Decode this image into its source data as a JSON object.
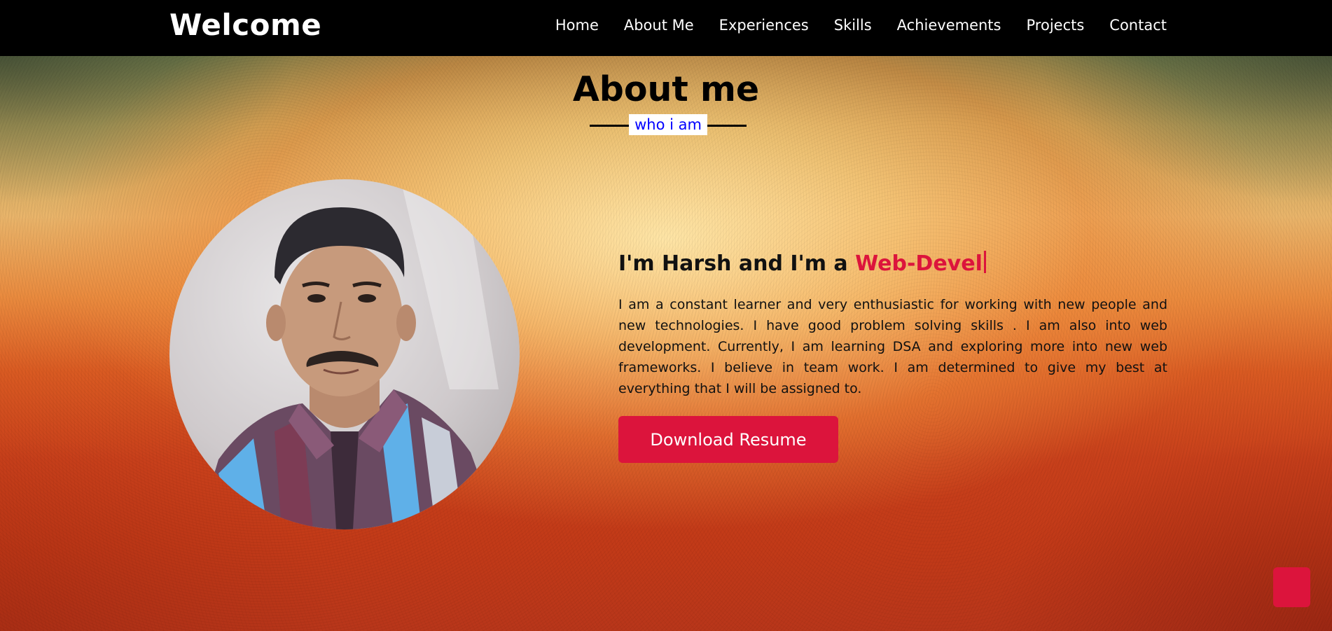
{
  "navbar": {
    "brand": "Welcome",
    "links": [
      "Home",
      "About Me",
      "Experiences",
      "Skills",
      "Achievements",
      "Projects",
      "Contact"
    ]
  },
  "about": {
    "title": "About me",
    "subtitle": "who i am",
    "intro_prefix": "I'm Harsh and I'm a ",
    "intro_role": "Web-Devel",
    "description": "I am a constant learner and very enthusiastic for working with new people and new technologies. I have good problem solving skills . I am also into web development. Currently, I am learning DSA and exploring more into new web frameworks. I believe in team work. I am determined to give my best at everything that I will be assigned to.",
    "button_label": "Download Resume"
  },
  "colors": {
    "accent": "#dc143c",
    "navbar_bg": "#000000",
    "subtitle_text": "#0000ff"
  },
  "icons": {
    "scroll_top": "arrow-up-icon"
  }
}
